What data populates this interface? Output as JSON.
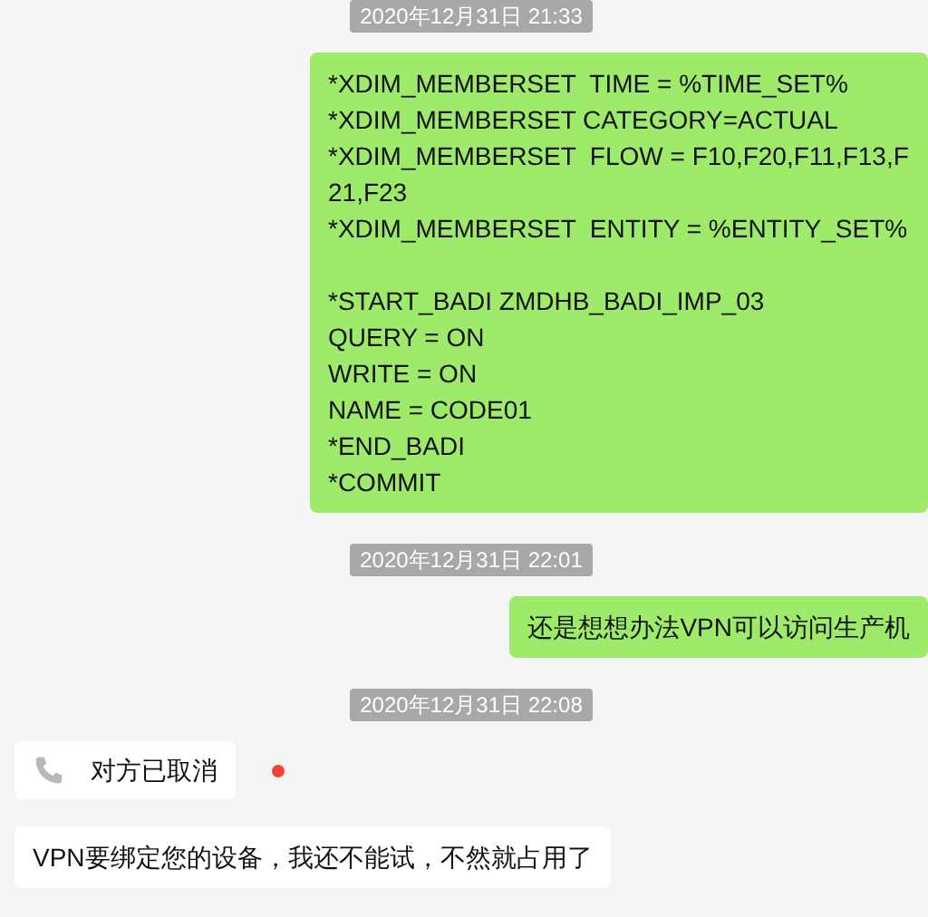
{
  "messages": [
    {
      "kind": "timestamp",
      "text": "2020年12月31日 21:33"
    },
    {
      "kind": "text",
      "outgoing": true,
      "text": "*XDIM_MEMBERSET  TIME = %TIME_SET%\n*XDIM_MEMBERSET CATEGORY=ACTUAL\n*XDIM_MEMBERSET  FLOW = F10,F20,F11,F13,F21,F23\n*XDIM_MEMBERSET  ENTITY = %ENTITY_SET%\n\n*START_BADI ZMDHB_BADI_IMP_03\nQUERY = ON\nWRITE = ON\nNAME = CODE01\n*END_BADI\n*COMMIT"
    },
    {
      "kind": "timestamp",
      "text": "2020年12月31日 22:01"
    },
    {
      "kind": "text",
      "outgoing": true,
      "text": "还是想想办法VPN可以访问生产机"
    },
    {
      "kind": "timestamp",
      "text": "2020年12月31日 22:08"
    },
    {
      "kind": "call",
      "outgoing": false,
      "text": "对方已取消",
      "unread": true
    },
    {
      "kind": "text",
      "outgoing": false,
      "text": "VPN要绑定您的设备，我还不能试，不然就占用了"
    }
  ]
}
